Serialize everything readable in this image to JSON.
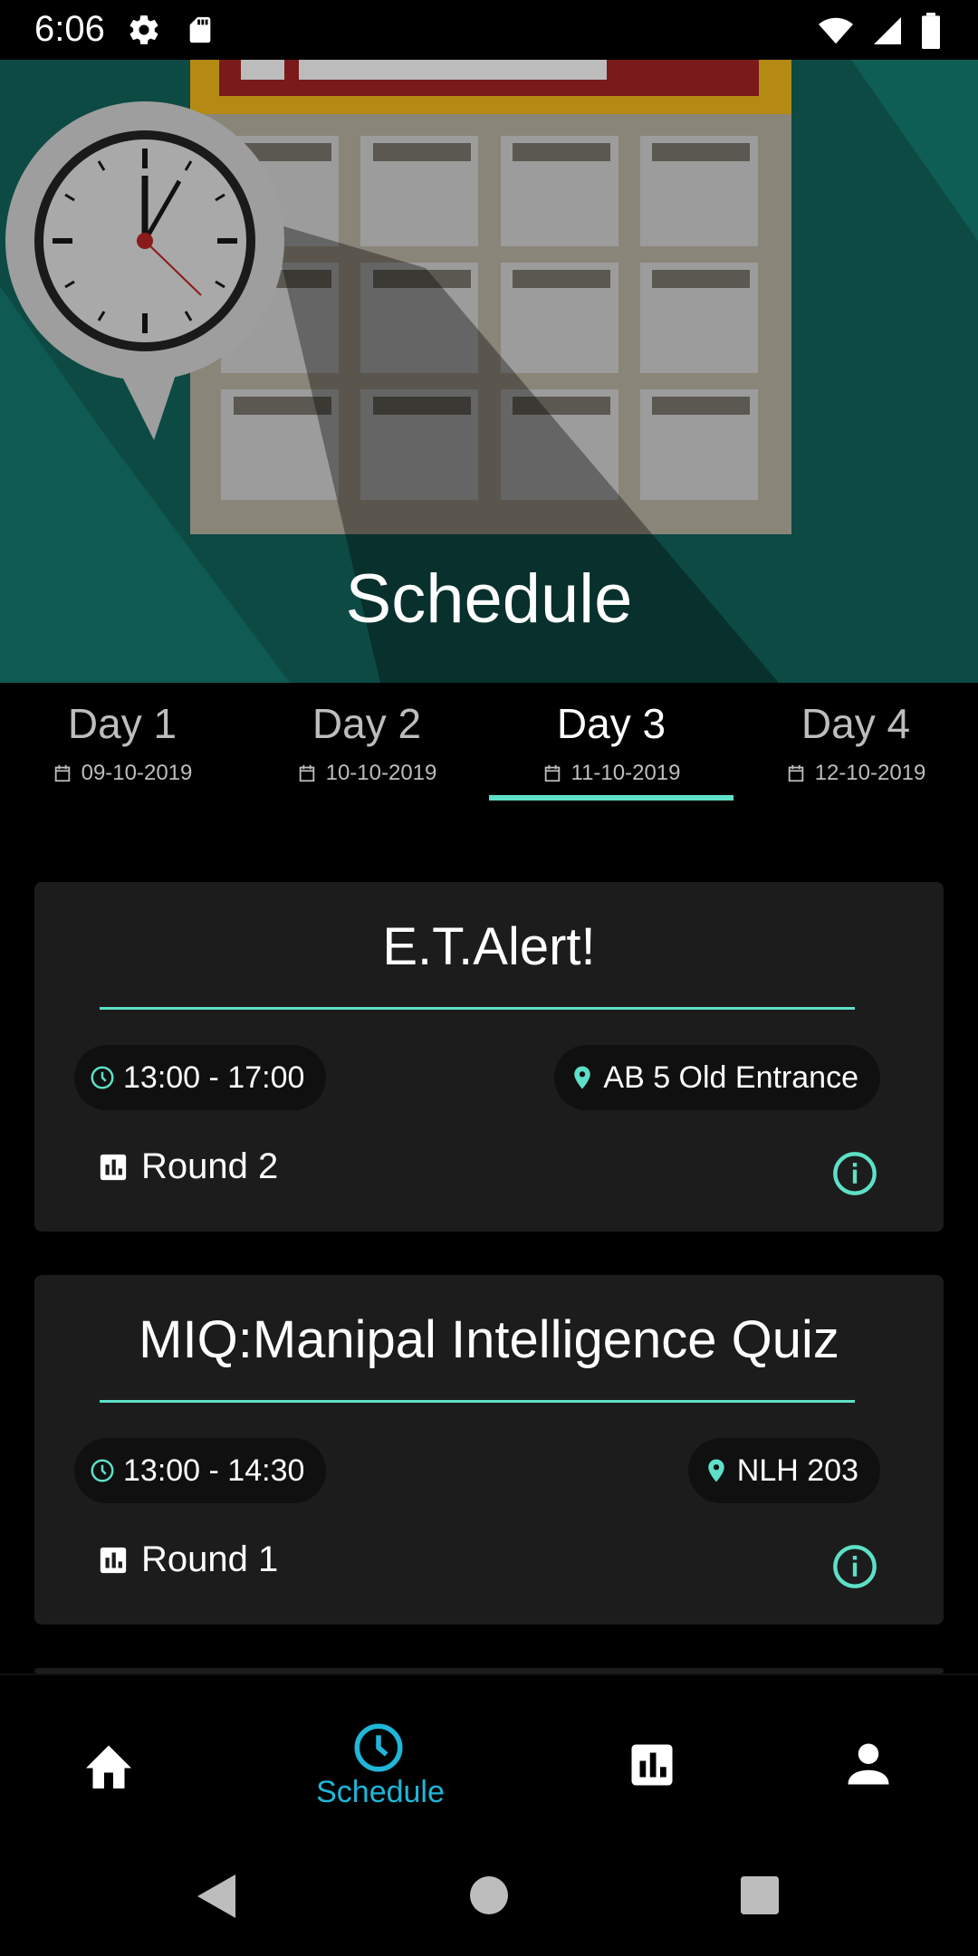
{
  "status_bar": {
    "time": "6:06",
    "icons_left": [
      "gear-icon",
      "sd-card-icon"
    ],
    "icons_right": [
      "wifi-icon",
      "signal-icon",
      "battery-icon"
    ]
  },
  "hero": {
    "title": "Schedule",
    "background_color": "#0d4a44"
  },
  "tabs": [
    {
      "label": "Day 1",
      "date": "09-10-2019",
      "active": false
    },
    {
      "label": "Day 2",
      "date": "10-10-2019",
      "active": false
    },
    {
      "label": "Day 3",
      "date": "11-10-2019",
      "active": true
    },
    {
      "label": "Day 4",
      "date": "12-10-2019",
      "active": false
    }
  ],
  "events": [
    {
      "title": "E.T.Alert!",
      "time": "13:00 - 17:00",
      "location": "AB 5 Old Entrance",
      "round": "Round 2"
    },
    {
      "title": "MIQ:Manipal Intelligence Quiz",
      "time": "13:00 - 14:30",
      "location": "NLH 203",
      "round": "Round 1"
    }
  ],
  "bottom_nav": {
    "items": [
      {
        "icon": "home-icon",
        "label": ""
      },
      {
        "icon": "clock-icon",
        "label": "Schedule",
        "active": true
      },
      {
        "icon": "bar-chart-icon",
        "label": ""
      },
      {
        "icon": "person-icon",
        "label": ""
      }
    ]
  },
  "system_nav": [
    "back-icon",
    "home-circle-icon",
    "recents-icon"
  ],
  "colors": {
    "accent_teal": "#5ee0c8",
    "nav_active": "#1fb6d8",
    "card_bg": "#1c1c1c"
  }
}
